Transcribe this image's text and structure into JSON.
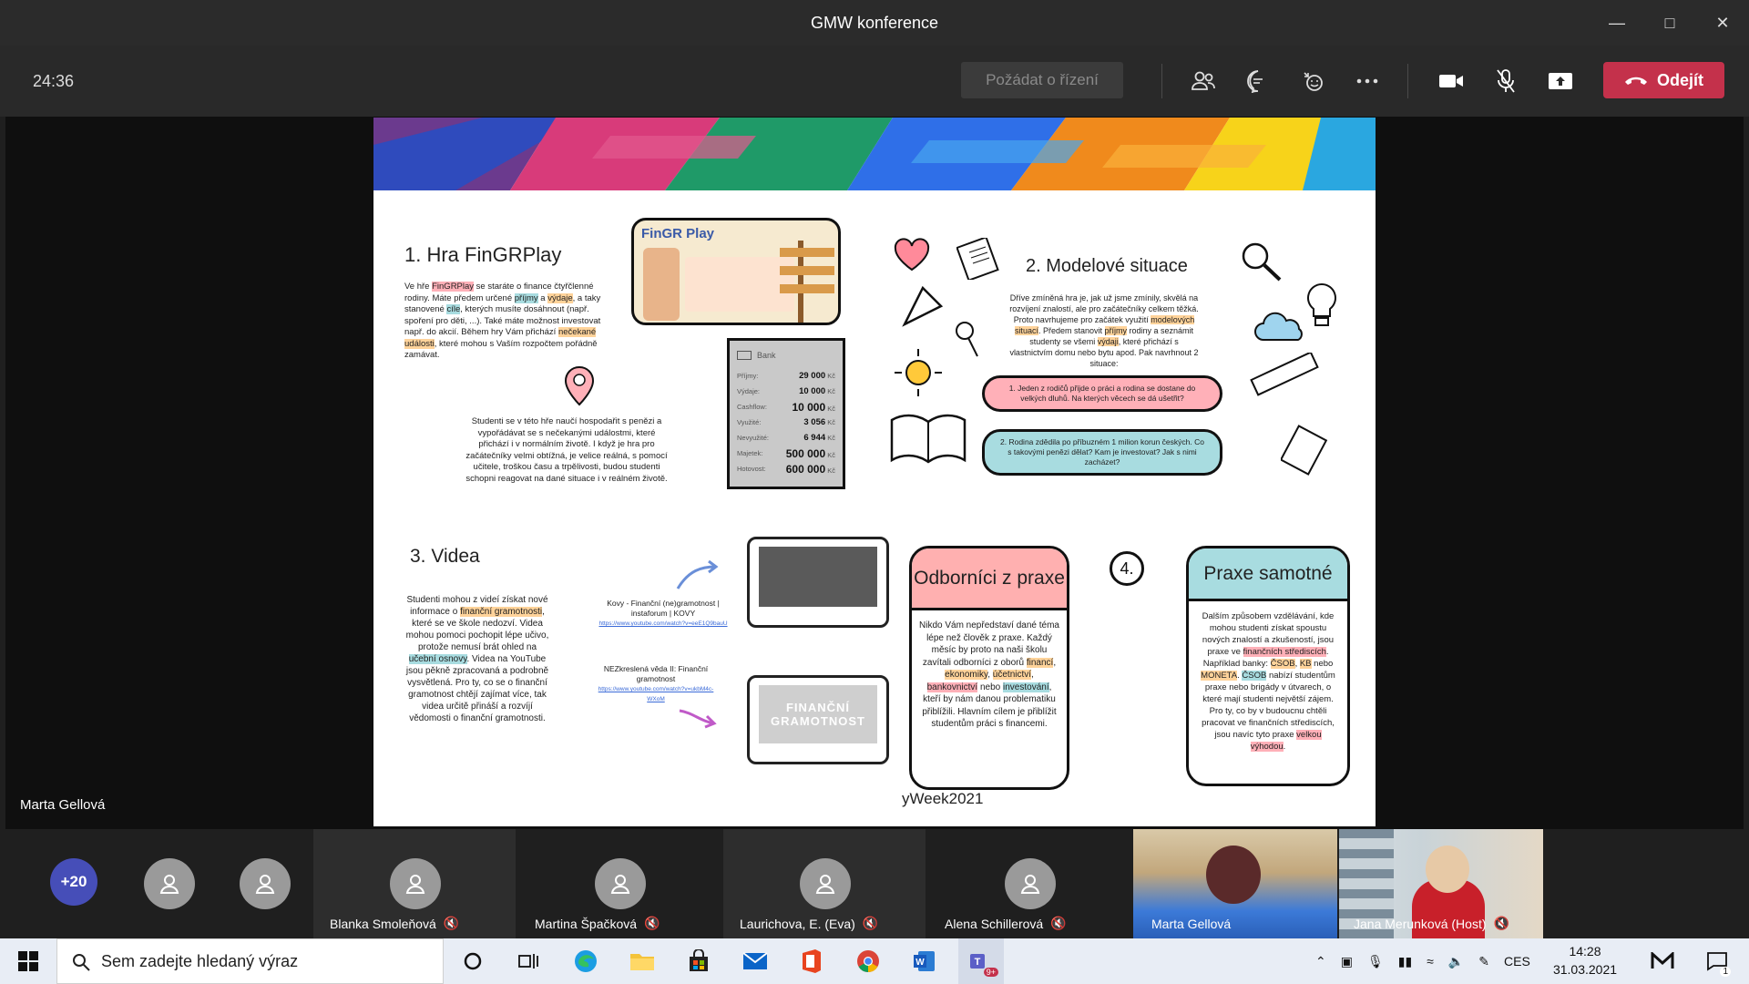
{
  "window": {
    "title": "GMW konference",
    "controls": [
      "minimize-icon",
      "maximize-icon",
      "close-icon"
    ]
  },
  "meeting": {
    "timer": "24:36",
    "request_control": "Požádat o řízení",
    "leave_label": "Odejít",
    "presenter": "Marta Gellová",
    "colors": {
      "leave": "#c4314b",
      "more_badge": "#464eb8"
    }
  },
  "slide": {
    "s1": {
      "heading": "1. Hra FinGRPlay",
      "p1_a": "Ve hře ",
      "p1_hl1": "FinGRPlay",
      "p1_b": " se staráte o finance čtyřčlenné rodiny. Máte předem určené ",
      "p1_hl2": "příjmy",
      "p1_c": " a ",
      "p1_hl3": "výdaje",
      "p1_d": ", a taky stanovené ",
      "p1_hl4": "cíle",
      "p1_e": ", kterých musíte dosáhnout (např. spoření pro děti, ...). Také máte možnost investovat např. do akcií. Během hry Vám přichází ",
      "p1_hl5": "nečekané události",
      "p1_f": ", které mohou s Vaším rozpočtem pořádně zamávat.",
      "p2": "Studenti se v této hře naučí hospodařit s penězi a vypořádávat se s nečekanými událostmi, které přichází i v normálním životě. I když je hra pro začátečníky velmi obtížná, je velice reálná, s pomocí učitele, troškou času a trpělivosti, budou studenti schopni reagovat na dané situace i v reálném životě.",
      "game_logo": "FinGR Play",
      "bank": {
        "title": "Bank",
        "rows": [
          {
            "label": "Příjmy:",
            "value": "29 000",
            "unit": "Kč"
          },
          {
            "label": "Výdaje:",
            "value": "10 000",
            "unit": "Kč"
          },
          {
            "label": "Cashflow:",
            "value": "10 000",
            "unit": "Kč"
          },
          {
            "label": "Využité:",
            "value": "3 056",
            "unit": "Kč"
          },
          {
            "label": "Nevyužité:",
            "value": "6 944",
            "unit": "Kč"
          },
          {
            "label": "Majetek:",
            "value": "500 000",
            "unit": "Kč"
          },
          {
            "label": "Hotovost:",
            "value": "600 000",
            "unit": "Kč"
          }
        ]
      }
    },
    "s2": {
      "heading": "2. Modelové situace",
      "p_a": "Dříve zmíněná hra je, jak už jsme zmínily, skvělá na rozvíjení znalostí, ale pro začátečníky celkem těžká. Proto navrhujeme pro začátek využití ",
      "p_hl1": "modelových situací",
      "p_b": ". Předem stanovit ",
      "p_hl2": "příjmy",
      "p_c": " rodiny a seznámit studenty se všemi ",
      "p_hl3": "výdaji",
      "p_d": ", které přichází s vlastnictvím domu nebo bytu apod. Pak navrhnout 2 situace:",
      "situation1": "1. Jeden z rodičů přijde o práci a rodina se dostane do velkých dluhů. Na kterých věcech se dá ušetřit?",
      "situation2": "2. Rodina zdědila po příbuzném 1 milion korun českých. Co s takovými penězi dělat? Kam je investovat? Jak s nimi zacházet?"
    },
    "s3": {
      "heading": "3. Videa",
      "p_a": "Studenti mohou z videí získat nové informace o ",
      "p_hl1": "finanční gramotnosti",
      "p_b": ", které se ve škole nedozví. Videa mohou pomoci pochopit lépe učivo, protože nemusí brát ohled na ",
      "p_hl2": "učební osnovy",
      "p_c": ". Videa na YouTube jsou pěkně zpracovaná a podrobně vysvětlená. Pro ty, co se o finanční gramotnost chtějí zajímat více, tak videa určitě přináší a rozvíjí vědomosti o finanční gramotnosti.",
      "video1_title": "Kovy - Finanční (ne)gramotnost | instaforum | KOVY",
      "video1_url": "https://www.youtube.com/watch?v=eeE1Q9bauU",
      "video2_title": "NEZkreslená věda II: Finanční gramotnost",
      "video2_url": "https://www.youtube.com/watch?v=ukbM4c-WXoM",
      "video2_screen": "FINANČNÍ GRAMOTNOST"
    },
    "s4": {
      "badge": "4.",
      "card1_title": "Odborníci z praxe",
      "card1_a": "Nikdo Vám nepředstaví dané téma lépe než člověk z praxe. Každý měsíc by proto na naši školu zavítali odborníci z oborů ",
      "card1_hl1": "financí",
      "card1_hl2": "ekonomiky",
      "card1_hl3": "účetnictví",
      "card1_hl4": "bankovnictví",
      "card1_mid": " nebo ",
      "card1_hl5": "investování",
      "card1_b": ", kteří by nám danou problematiku přiblížili. Hlavním cílem je přiblížit studentům práci s financemi.",
      "card2_title": "Praxe samotné",
      "card2_a": "Dalším způsobem vzdělávání, kde mohou studenti získat spoustu nových znalostí a zkušeností, jsou praxe ve ",
      "card2_hl1": "finančních střediscích",
      "card2_b": ". Například banky: ",
      "card2_hl2": "ČSOB",
      "card2_c": ", ",
      "card2_hl3": "KB",
      "card2_d": " nebo ",
      "card2_hl4": "MONETA",
      "card2_e": ". ",
      "card2_hl5": "ČSOB",
      "card2_f": " nabízí studentům praxe nebo brigády v útvarech, o které mají studenti největší zájem. Pro ty, co by v budoucnu chtěli pracovat ve finančních střediscích, jsou navíc tyto praxe ",
      "card2_hl6": "velkou výhodou",
      "card2_g": ".",
      "footer": "yWeek2021"
    }
  },
  "participants": {
    "more": "+20",
    "people": [
      {
        "name": "Blanka Smoleňová"
      },
      {
        "name": "Martina Špačková"
      },
      {
        "name": "Laurichova, E. (Eva)"
      },
      {
        "name": "Alena Schillerová"
      },
      {
        "name": "Marta Gellová"
      },
      {
        "name": "Jana Merunková (Host)"
      }
    ]
  },
  "taskbar": {
    "search_placeholder": "Sem zadejte hledaný výraz",
    "lang": "CES",
    "time": "14:28",
    "date": "31.03.2021",
    "teams_badge": "9+",
    "notif_count": "1"
  }
}
